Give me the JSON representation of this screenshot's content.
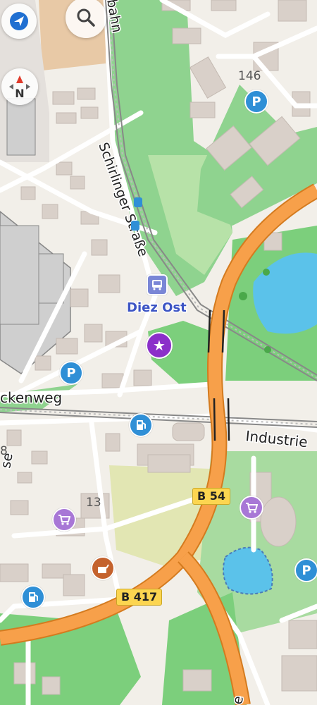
{
  "map": {
    "streets": {
      "schirlinger": "Schirlinger Straße",
      "bahn_partial": "bahn",
      "weg_partial": "ckenweg",
      "industrie_partial": "Industrie",
      "bottom_partial": "e",
      "left_partial": "se"
    },
    "station_label": "Diez Ost",
    "house_numbers": {
      "n146": "146",
      "n13": "13",
      "n8": "8"
    },
    "road_shields": {
      "b54": "B 54",
      "b417": "B 417"
    },
    "compass_letter": "N",
    "colors": {
      "background": "#f2efe9",
      "park": "#7ccf7c",
      "park_light": "#c8e6b4",
      "motorway": "#f7a04a",
      "water": "#5bc2ea",
      "building": "#d9d0c9",
      "rail": "#9a9a9a",
      "poi_blue": "#2f8fd6",
      "poi_purple": "#a877d6"
    },
    "icons": [
      "locate-icon",
      "search-icon",
      "compass-icon",
      "parking-icon",
      "fuel-icon",
      "shop-icon",
      "bus-stop-icon",
      "favorite-star-icon"
    ]
  }
}
